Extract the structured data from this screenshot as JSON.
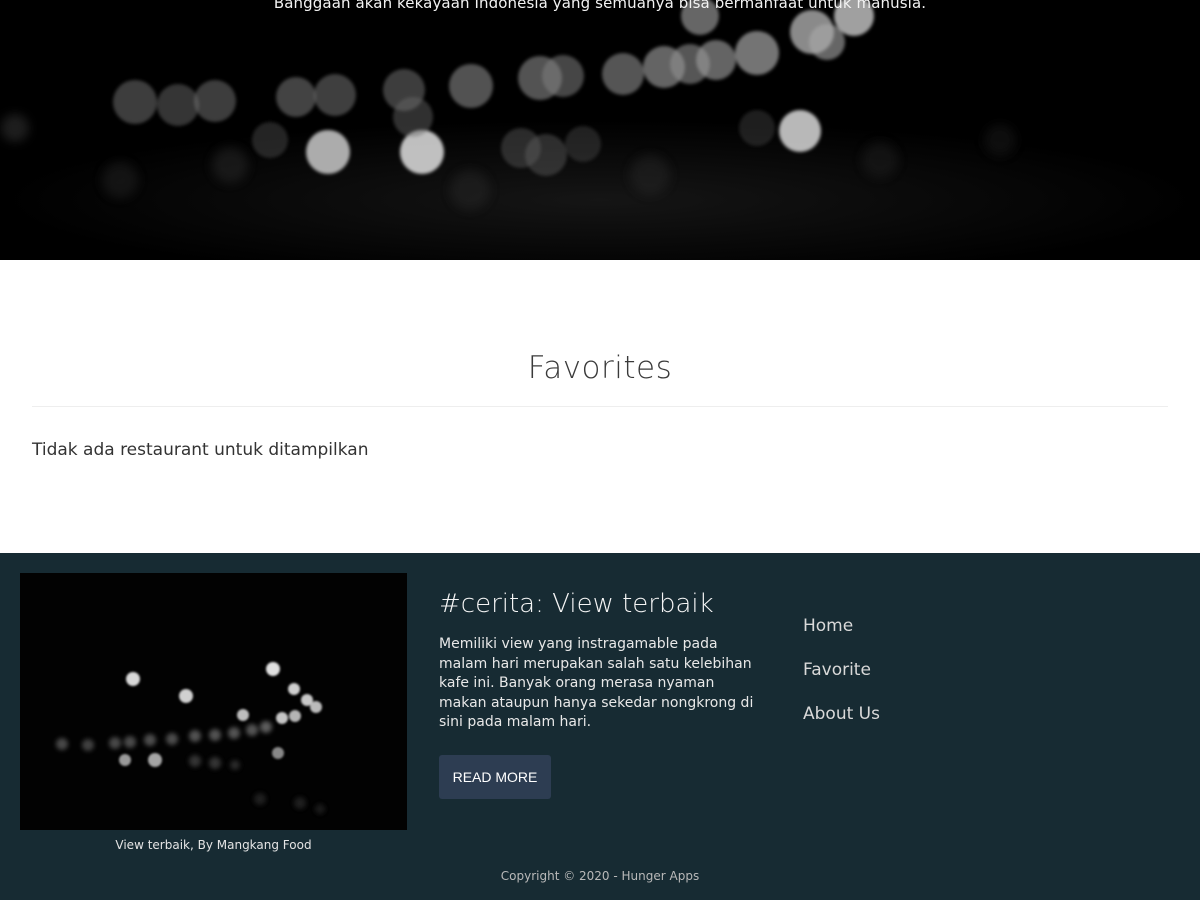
{
  "hero": {
    "tagline": "Banggaan akan kekayaan Indonesia yang semuanya bisa bermanfaat untuk manusia.",
    "background_color": "#000000"
  },
  "favorites": {
    "title": "Favorites",
    "empty_message": "Tidak ada restaurant untuk ditampilkan"
  },
  "footer": {
    "background_color": "#172b33",
    "photo_caption": "View terbaik, By Mangkang Food",
    "story": {
      "title": "#cerita: View terbaik",
      "body": "Memiliki view yang instragamable pada malam hari merupakan salah satu kelebihan kafe ini. Banyak orang merasa nyaman makan ataupun hanya sekedar nongkrong di sini pada malam hari.",
      "button_label": "READ MORE",
      "button_color": "#2d3d52"
    },
    "nav": [
      {
        "label": "Home"
      },
      {
        "label": "Favorite"
      },
      {
        "label": "About Us"
      }
    ],
    "copyright": "Copyright © 2020 - Hunger Apps"
  }
}
